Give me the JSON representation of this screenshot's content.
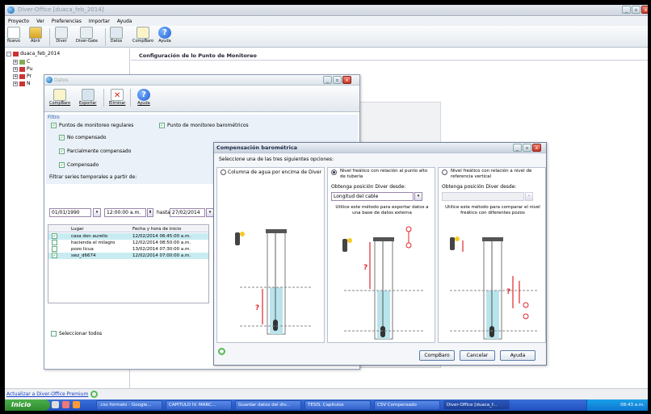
{
  "app": {
    "title": "Diver-Office [duaca_feb_2014]"
  },
  "menu": [
    "Proyecto",
    "Ver",
    "Preferencias",
    "Importar",
    "Ayuda"
  ],
  "toolbar": [
    {
      "label": "Nuevo",
      "icon": "new-document-icon"
    },
    {
      "label": "Abrir",
      "icon": "folder-open-icon"
    },
    {
      "label": "Diver",
      "icon": "diver-icon"
    },
    {
      "label": "Diver-Gate",
      "icon": "diver-gate-icon"
    },
    {
      "label": "Datos",
      "icon": "data-icon"
    },
    {
      "label": "CompBaro",
      "icon": "compbaro-icon"
    },
    {
      "label": "Ayuda",
      "icon": "help-icon"
    }
  ],
  "tree": {
    "root": "duaca_feb_2014",
    "children": [
      "C",
      "Pu",
      "Pr",
      "N"
    ]
  },
  "main": {
    "heading": "Configuración de lo Punto de Monitoreo"
  },
  "datos": {
    "title": "Datos",
    "toolbar": [
      "CompBaro",
      "Exportar",
      "Eliminar",
      "Ayuda"
    ],
    "filter_label": "Filtro",
    "cb_regular": "Puntos de monitoreo regulares",
    "cb_baro": "Punto de monitoreo barométricos",
    "cb_no_comp": "No compensado",
    "cb_partial": "Parcialmente compensado",
    "cb_comp": "Compensado",
    "series_label": "Filtrar series temporales a partir de:",
    "date_from": "01/01/1990",
    "time_from": "12:00:00 a.m.",
    "hasta": "hasta",
    "date_to": "27/02/2014",
    "grid_headers": [
      "Lugar",
      "Fecha y hora de inicio"
    ],
    "rows": [
      {
        "lugar": "casa don aurelio",
        "fecha": "12/02/2014 06:45:00 a.m.",
        "checked": true
      },
      {
        "lugar": "hacienda el milagro",
        "fecha": "12/02/2014 08:50:00 a.m.",
        "checked": false
      },
      {
        "lugar": "pozo licua",
        "fecha": "13/02/2014 07:30:00 a.m.",
        "checked": false
      },
      {
        "lugar": "swz_d6674",
        "fecha": "12/02/2014 07:00:00 a.m.",
        "checked": true
      }
    ],
    "select_all": "Seleccionar todos"
  },
  "comp": {
    "title": "Compensación barométrica",
    "instruction": "Seleccione una de las tres siguientes opciones:",
    "opt1": "Columna de agua por encima de Diver",
    "opt2": "Nivel freático con relación al punto alto de tubería",
    "opt3": "Nivel freático con relación a nivel de referencia vertical",
    "obtain_label": "Obtenga posición Diver desde:",
    "dropdown_value": "Longitud del cable",
    "desc2": "Utilice este método para exportar datos a una base de datos externa",
    "desc3": "Utilice este método para comparar el nivel freático con diferentes pozos",
    "btn_compbaro": "CompBaro",
    "btn_cancel": "Cancelar",
    "btn_help": "Ayuda"
  },
  "status": {
    "link": "Actualizar a Diver-Office Premium"
  },
  "taskbar": {
    "start": "Inicio",
    "tasks": [
      ".csv formato - Google...",
      "CAPITULO IV. MARC...",
      "Guardar datos del div...",
      "TESIS. Capitulos",
      "CSV Compensado",
      "Diver-Office [duaca_f..."
    ],
    "clock": "08:43 a.m."
  },
  "colors": {
    "accent": "#1f4fc0",
    "selection": "#c9ecf3",
    "water": "#b9e4ec",
    "marker": "#e0242a"
  }
}
